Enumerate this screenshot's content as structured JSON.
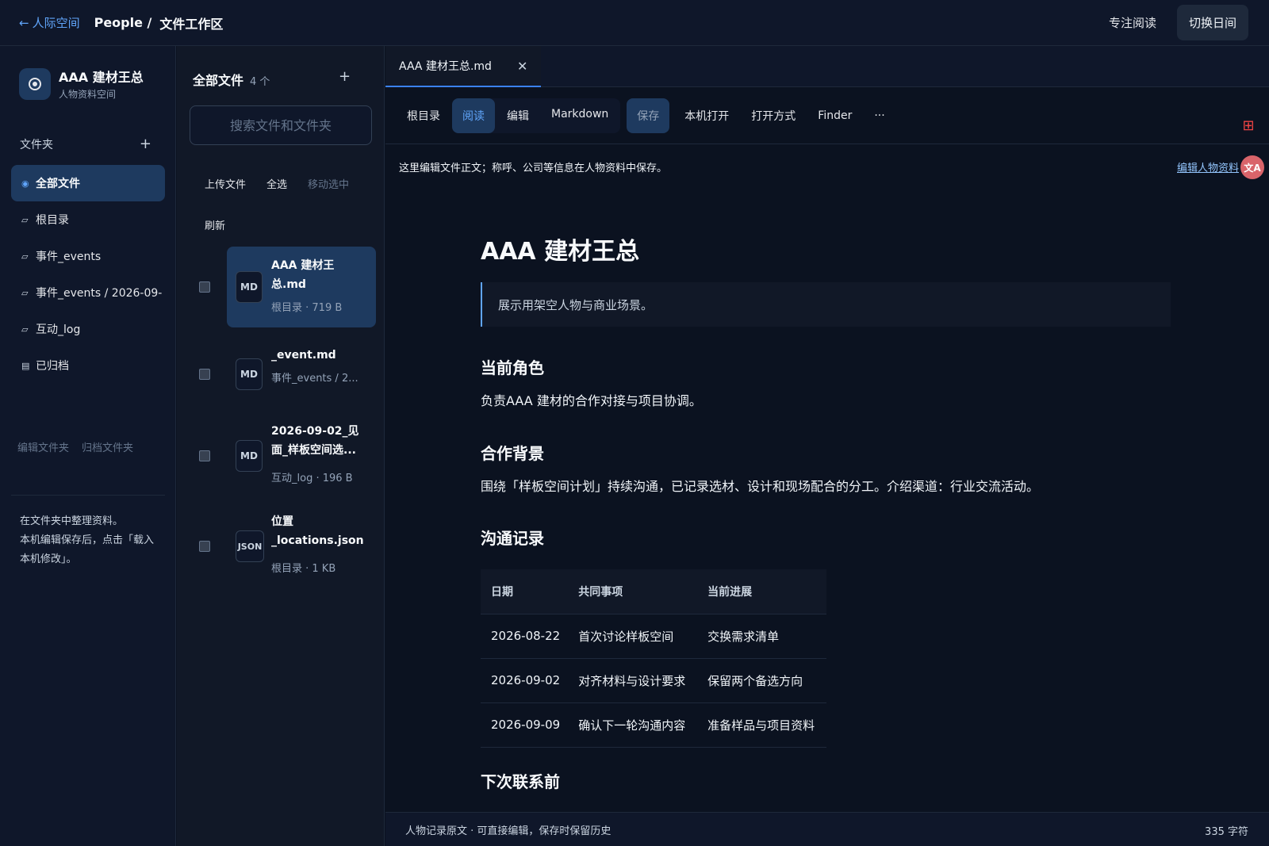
{
  "topbar": {
    "back_label": "人际空间",
    "crumb_root": "People /",
    "crumb_current": "文件工作区",
    "focus_label": "专注阅读",
    "daymode_label": "切换日间"
  },
  "sidebar": {
    "profile_name": "AAA 建材王总",
    "profile_sub": "人物资料空间",
    "folders_heading": "文件夹",
    "items": [
      {
        "label": "全部文件",
        "icon": "◉"
      },
      {
        "label": "根目录",
        "icon": "▱"
      },
      {
        "label": "事件_events",
        "icon": "▱"
      },
      {
        "label": "事件_events / 2026-09-",
        "icon": "▱"
      },
      {
        "label": "互动_log",
        "icon": "▱"
      },
      {
        "label": "已归档",
        "icon": "▤"
      }
    ],
    "edit_folder": "编辑文件夹",
    "archive_folder": "归档文件夹",
    "note_line1": "在文件夹中整理资料。",
    "note_line2": "本机编辑保存后，点击「载入本机修改」。"
  },
  "files": {
    "title": "全部文件",
    "count": "4 个",
    "search_placeholder": "搜索文件和文件夹",
    "upload": "上传文件",
    "select_all": "全选",
    "move_selected": "移动选中",
    "refresh": "刷新",
    "items": [
      {
        "badge": "MD",
        "name": "AAA 建材王总.md",
        "meta": "根目录 · 719 B"
      },
      {
        "badge": "MD",
        "name": "_event.md",
        "meta": "事件_events / 2..."
      },
      {
        "badge": "MD",
        "name": "2026-09-02_见面_样板空间选...",
        "meta": "互动_log · 196 B"
      },
      {
        "badge": "JSON",
        "name": "位置_locations.json",
        "meta": "根目录 · 1 KB"
      }
    ]
  },
  "editor": {
    "tab_label": "AAA 建材王总.md",
    "toolbar": {
      "root": "根目录",
      "read": "阅读",
      "edit": "编辑",
      "markdown": "Markdown",
      "save": "保存",
      "open_local": "本机打开",
      "open_with": "打开方式",
      "finder": "Finder",
      "more": "···"
    },
    "hint": "这里编辑文件正文；称呼、公司等信息在人物资料中保存。",
    "hint_link": "编辑人物资料",
    "doc": {
      "title": "AAA 建材王总",
      "quote": "展示用架空人物与商业场景。",
      "h_role": "当前角色",
      "p_role": "负责AAA 建材的合作对接与项目协调。",
      "h_background": "合作背景",
      "p_background": "围绕「样板空间计划」持续沟通，已记录选材、设计和现场配合的分工。介绍渠道：行业交流活动。",
      "h_log": "沟通记录",
      "table_headers": [
        "日期",
        "共同事项",
        "当前进展"
      ],
      "table_rows": [
        [
          "2026-08-22",
          "首次讨论样板空间",
          "交换需求清单"
        ],
        [
          "2026-09-02",
          "对齐材料与设计要求",
          "保留两个备选方向"
        ],
        [
          "2026-09-09",
          "确认下一轮沟通内容",
          "准备样品与项目资料"
        ]
      ],
      "h_next": "下次联系前"
    },
    "status_text": "人物记录原文 · 可直接编辑，保存时保留历史",
    "char_count": "335 字符"
  },
  "colors": {
    "accent": "#60a5fa",
    "active_bg": "#1e3a5f",
    "background": "#0b1220"
  }
}
